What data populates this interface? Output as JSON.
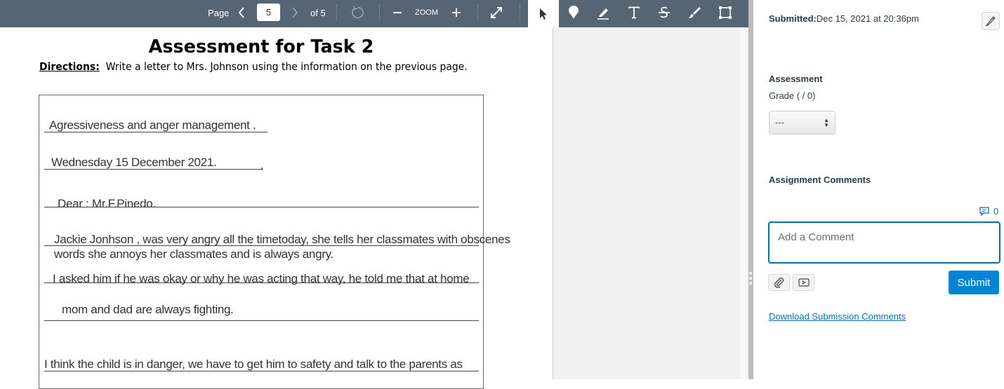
{
  "toolbar": {
    "page_label": "Page",
    "page_value": "5",
    "page_total": "of 5",
    "zoom_label": "ZOOM",
    "icons": [
      "chevron-left-icon",
      "chevron-right-icon",
      "rotate-icon",
      "zoom-out-icon",
      "zoom-in-icon",
      "fullscreen-icon"
    ]
  },
  "annotation_tools": [
    "select-pointer",
    "point-pin",
    "highlight",
    "text",
    "strikeout",
    "freehand-draw",
    "area-box"
  ],
  "document": {
    "title": "Assessment for Task 2",
    "directions_label": "Directions:",
    "directions_text": "Write a letter to Mrs. Johnson using the information on the previous page.",
    "lines": [
      "Agressiveness and  anger management .",
      "Wednesday 15 December 2021.",
      "Dear : Mr.F.Pinedo.",
      "Jackie Jonhson , was very angry all the timetoday, she tells her classmates with obscenes",
      "words she annoys her classmates and is always angry.",
      "I asked him if he was okay or why he was acting that way, he told me that at home",
      "mom and dad are always fighting.",
      "I think the child is in danger, we have to get him to safety and talk to the parents as"
    ],
    "comma": ","
  },
  "panel": {
    "submitted_label": "Submitted:",
    "submitted_value": "Dec 15, 2021 at 20:36pm",
    "assessment_label": "Assessment",
    "grade_label": "Grade ( / 0)",
    "grade_value": "---",
    "comments_label": "Assignment Comments",
    "comment_count": "0",
    "comment_placeholder": "Add a Comment",
    "submit_label": "Submit",
    "download_link": "Download Submission Comments",
    "accent_color": "#0084d5",
    "link_color": "#0770a3"
  }
}
